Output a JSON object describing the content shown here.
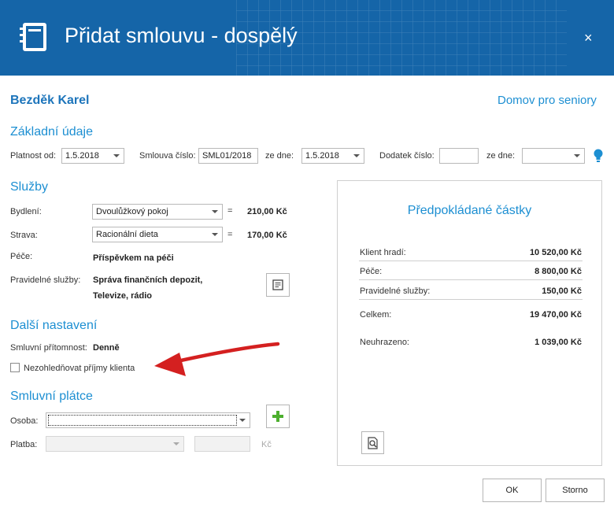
{
  "header": {
    "title": "Přidat smlouvu - dospělý",
    "close": "×"
  },
  "client": {
    "name": "Bezděk Karel",
    "facility": "Domov pro seniory"
  },
  "basic": {
    "section": "Základní údaje",
    "valid_from_label": "Platnost od:",
    "valid_from": "1.5.2018",
    "contract_no_label": "Smlouva číslo:",
    "contract_no": "SML01/2018",
    "of_date_label": "ze dne:",
    "of_date": "1.5.2018",
    "amendment_label": "Dodatek číslo:",
    "amendment": "",
    "amend_date_label": "ze dne:",
    "amend_date": ""
  },
  "services": {
    "section": "Služby",
    "housing_label": "Bydlení:",
    "housing": "Dvoulůžkový pokoj",
    "housing_price": "210,00 Kč",
    "food_label": "Strava:",
    "food": "Racionální dieta",
    "food_price": "170,00 Kč",
    "care_label": "Péče:",
    "care": "Příspěvkem na péči",
    "regular_label": "Pravidelné služby:",
    "regular_line1": "Správa finančních depozit,",
    "regular_line2": "Televize, rádio",
    "eq": "="
  },
  "settings": {
    "section": "Další nastavení",
    "presence_label": "Smluvní přítomnost:",
    "presence": "Denně",
    "ignore_income_label": "Nezohledňovat příjmy klienta"
  },
  "payer": {
    "section": "Smluvní plátce",
    "person_label": "Osoba:",
    "person": "",
    "payment_label": "Platba:",
    "payment": "",
    "amount": "",
    "currency": "Kč"
  },
  "estimates": {
    "title": "Předpokládané částky",
    "rows": [
      {
        "label": "Klient hradí:",
        "value": "10 520,00 Kč"
      },
      {
        "label": "Péče:",
        "value": "8 800,00 Kč"
      },
      {
        "label": "Pravidelné služby:",
        "value": "150,00 Kč"
      }
    ],
    "total_label": "Celkem:",
    "total": "19 470,00 Kč",
    "unpaid_label": "Neuhrazeno:",
    "unpaid": "1 039,00 Kč"
  },
  "buttons": {
    "ok": "OK",
    "cancel": "Storno"
  },
  "colors": {
    "header": "#1565a8",
    "accent": "#1d8fd2",
    "arrow": "#d42020",
    "add": "#4caf2e"
  }
}
